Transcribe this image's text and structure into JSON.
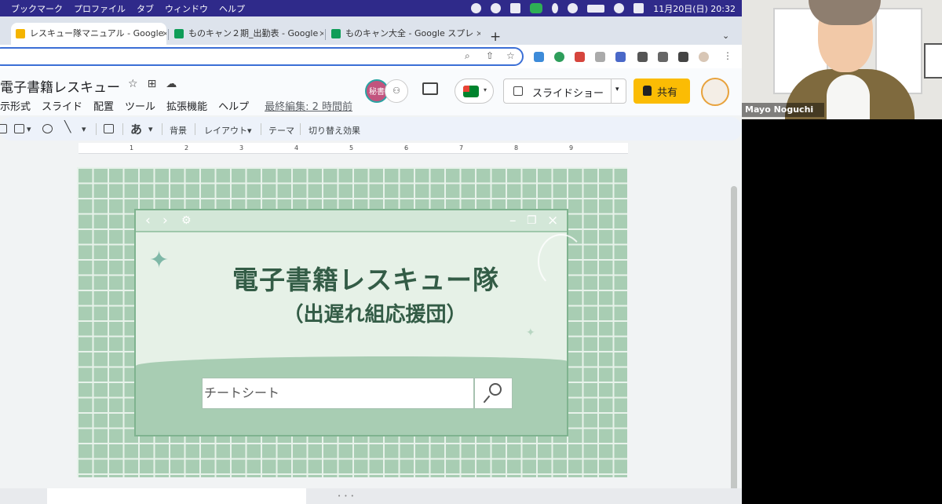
{
  "menubar": {
    "items": [
      "ブックマーク",
      "プロファイル",
      "タブ",
      "ウィンドウ",
      "ヘルプ"
    ],
    "clock": "11月20日(日)  20:32",
    "icons": [
      "cursor-icon",
      "play-icon",
      "text-input-icon",
      "line-app-icon",
      "bluetooth-icon",
      "wifi-icon",
      "battery-icon",
      "spotlight-icon",
      "control-center-icon"
    ]
  },
  "browser": {
    "tabs": [
      {
        "title": "レスキュー隊マニュアル - Google",
        "icon": "slides",
        "active": true
      },
      {
        "title": "ものキャン２期_出勤表 - Google",
        "icon": "sheets",
        "active": false
      },
      {
        "title": "ものキャン大全 - Google スプレ",
        "icon": "sheets",
        "active": false
      }
    ],
    "new_tab": "+",
    "close": "×"
  },
  "doc": {
    "title": "電子書籍レスキュー",
    "menus": [
      "示形式",
      "スライド",
      "配置",
      "ツール",
      "拡張機能",
      "ヘルプ"
    ],
    "last_edit": "最終編集: 2 時間前",
    "collab_avatar_text": "秘書",
    "slideshow_label": "スライドショー",
    "share_label": "共有"
  },
  "toolbar": {
    "font_glyph": "あ",
    "background": "背景",
    "layout": "レイアウト▾",
    "theme": "テーマ",
    "transition": "切り替え効果"
  },
  "ruler": [
    "1",
    "2",
    "3",
    "4",
    "5",
    "6",
    "7",
    "8",
    "9"
  ],
  "slide": {
    "title": "電子書籍レスキュー隊",
    "subtitle": "（出遅れ組応援団）",
    "search_text": "チートシート",
    "colors": {
      "grid_bg": "#a8cdb3",
      "window_bg": "#e6f1e7",
      "title": "#335c46"
    }
  },
  "video": {
    "participant_name": "Mayo Noguchi"
  }
}
